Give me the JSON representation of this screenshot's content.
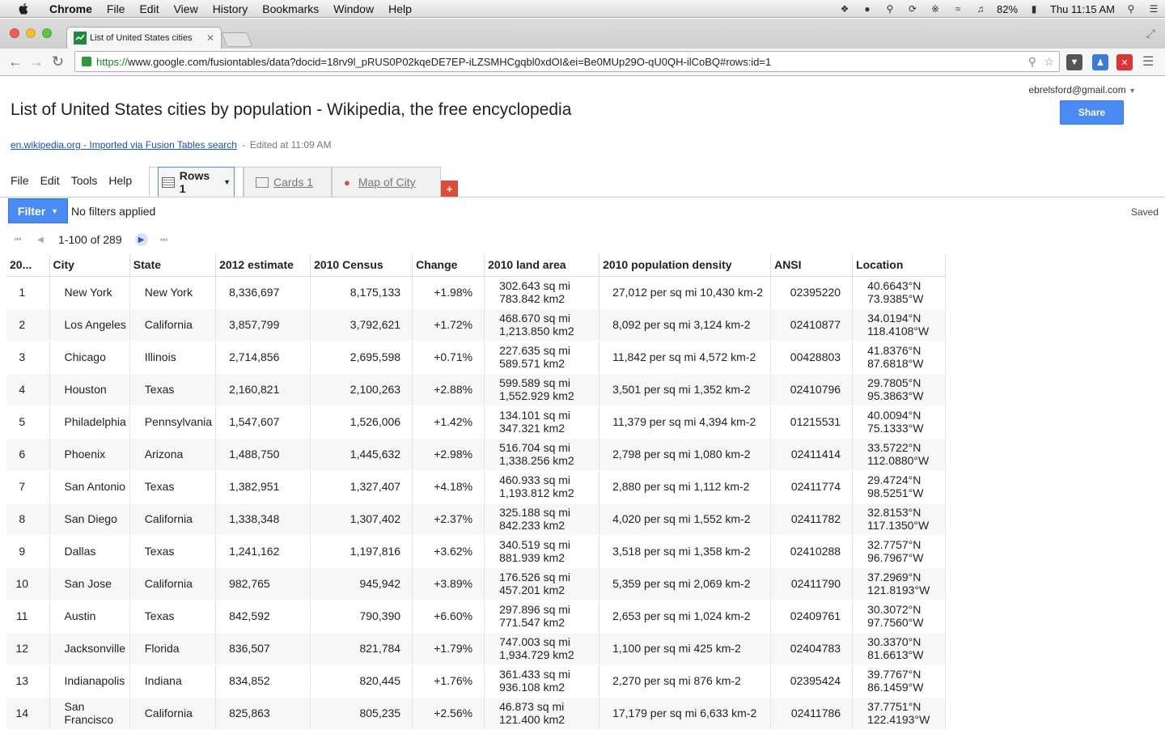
{
  "menubar": {
    "app": "Chrome",
    "items": [
      "File",
      "Edit",
      "View",
      "History",
      "Bookmarks",
      "Window",
      "Help"
    ],
    "battery": "82%",
    "clock": "Thu 11:15 AM"
  },
  "browser": {
    "tab_title": "List of United States cities",
    "url_scheme": "https://",
    "url_rest": "www.google.com/fusiontables/data?docid=18rv9l_pRUS0P02kqeDE7EP-iLZSMHCgqbl0xdOI&ei=Be0MUp29O-qU0QH-ilCoBQ#rows:id=1"
  },
  "page": {
    "account": "ebrelsford@gmail.com",
    "share_label": "Share",
    "title": "List of United States cities by population - Wikipedia, the free encyclopedia",
    "source_link": "en.wikipedia.org - Imported via Fusion Tables search",
    "source_sep": "-",
    "edited": "Edited at 11:09 AM",
    "menu": [
      "File",
      "Edit",
      "Tools",
      "Help"
    ],
    "tabs": {
      "rows": "Rows 1",
      "cards": "Cards 1",
      "map": "Map of City"
    },
    "add_tab": "+",
    "filter_label": "Filter",
    "filter_status": "No filters applied",
    "saved": "Saved",
    "pager": "1-100 of 289"
  },
  "table": {
    "headers": [
      "20...",
      "City",
      "State",
      "2012 estimate",
      "2010 Census",
      "Change",
      "2010 land area",
      "2010 population density",
      "ANSI",
      "Location"
    ],
    "rows": [
      [
        "1",
        "New York",
        "New York",
        "8,336,697",
        "8,175,133",
        "+1.98%",
        "302.643 sq mi 783.842 km2",
        "27,012 per sq mi 10,430 km-2",
        "02395220",
        "40.6643°N 73.9385°W"
      ],
      [
        "2",
        "Los Angeles",
        "California",
        "3,857,799",
        "3,792,621",
        "+1.72%",
        "468.670 sq mi 1,213.850 km2",
        "8,092 per sq mi 3,124 km-2",
        "02410877",
        "34.0194°N 118.4108°W"
      ],
      [
        "3",
        "Chicago",
        "Illinois",
        "2,714,856",
        "2,695,598",
        "+0.71%",
        "227.635 sq mi 589.571 km2",
        "11,842 per sq mi 4,572 km-2",
        "00428803",
        "41.8376°N 87.6818°W"
      ],
      [
        "4",
        "Houston",
        "Texas",
        "2,160,821",
        "2,100,263",
        "+2.88%",
        "599.589 sq mi 1,552.929 km2",
        "3,501 per sq mi 1,352 km-2",
        "02410796",
        "29.7805°N 95.3863°W"
      ],
      [
        "5",
        "Philadelphia",
        "Pennsylvania",
        "1,547,607",
        "1,526,006",
        "+1.42%",
        "134.101 sq mi 347.321 km2",
        "11,379 per sq mi 4,394 km-2",
        "01215531",
        "40.0094°N 75.1333°W"
      ],
      [
        "6",
        "Phoenix",
        "Arizona",
        "1,488,750",
        "1,445,632",
        "+2.98%",
        "516.704 sq mi 1,338.256 km2",
        "2,798 per sq mi 1,080 km-2",
        "02411414",
        "33.5722°N 112.0880°W"
      ],
      [
        "7",
        "San Antonio",
        "Texas",
        "1,382,951",
        "1,327,407",
        "+4.18%",
        "460.933 sq mi 1,193.812 km2",
        "2,880 per sq mi 1,112 km-2",
        "02411774",
        "29.4724°N 98.5251°W"
      ],
      [
        "8",
        "San Diego",
        "California",
        "1,338,348",
        "1,307,402",
        "+2.37%",
        "325.188 sq mi 842.233 km2",
        "4,020 per sq mi 1,552 km-2",
        "02411782",
        "32.8153°N 117.1350°W"
      ],
      [
        "9",
        "Dallas",
        "Texas",
        "1,241,162",
        "1,197,816",
        "+3.62%",
        "340.519 sq mi 881.939 km2",
        "3,518 per sq mi 1,358 km-2",
        "02410288",
        "32.7757°N 96.7967°W"
      ],
      [
        "10",
        "San Jose",
        "California",
        "982,765",
        "945,942",
        "+3.89%",
        "176.526 sq mi 457.201 km2",
        "5,359 per sq mi 2,069 km-2",
        "02411790",
        "37.2969°N 121.8193°W"
      ],
      [
        "11",
        "Austin",
        "Texas",
        "842,592",
        "790,390",
        "+6.60%",
        "297.896 sq mi 771.547 km2",
        "2,653 per sq mi 1,024 km-2",
        "02409761",
        "30.3072°N 97.7560°W"
      ],
      [
        "12",
        "Jacksonville",
        "Florida",
        "836,507",
        "821,784",
        "+1.79%",
        "747.003 sq mi 1,934.729 km2",
        "1,100 per sq mi 425 km-2",
        "02404783",
        "30.3370°N 81.6613°W"
      ],
      [
        "13",
        "Indianapolis",
        "Indiana",
        "834,852",
        "820,445",
        "+1.76%",
        "361.433 sq mi 936.108 km2",
        "2,270 per sq mi 876 km-2",
        "02395424",
        "39.7767°N 86.1459°W"
      ],
      [
        "14",
        "San Francisco",
        "California",
        "825,863",
        "805,235",
        "+2.56%",
        "46.873 sq mi 121.400 km2",
        "17,179 per sq mi 6,633 km-2",
        "02411786",
        "37.7751°N 122.4193°W"
      ]
    ]
  }
}
